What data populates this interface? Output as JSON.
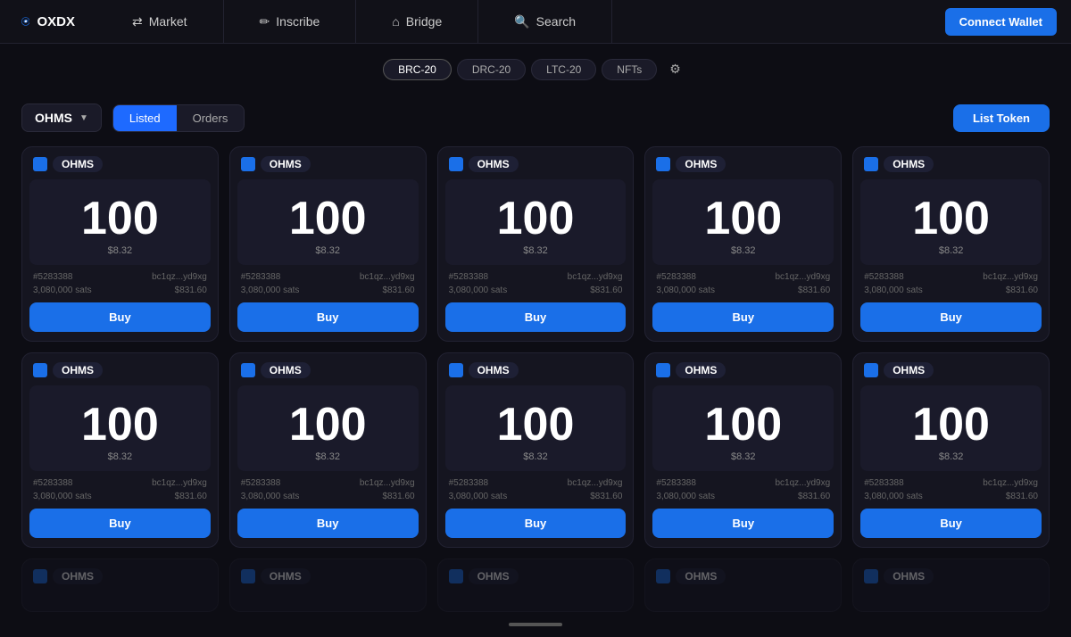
{
  "brand": {
    "name": "OXDX"
  },
  "nav": {
    "items": [
      {
        "label": "Market",
        "icon": "⇄"
      },
      {
        "label": "Inscribe",
        "icon": "✏"
      },
      {
        "label": "Bridge",
        "icon": "⌂"
      },
      {
        "label": "Search",
        "icon": "🔍"
      }
    ],
    "connect_wallet_label": "Connect Wallet"
  },
  "token_tabs": [
    {
      "label": "BRC-20",
      "active": true
    },
    {
      "label": "DRC-20",
      "active": false
    },
    {
      "label": "LTC-20",
      "active": false
    },
    {
      "label": "NFTs",
      "active": false
    }
  ],
  "filter": {
    "token": "OHMS",
    "views": [
      "Listed",
      "Orders"
    ],
    "active_view": "Listed",
    "list_token_label": "List Token"
  },
  "cards": [
    {
      "id": "#5283388",
      "wallet": "bc1qz...yd9xg",
      "amount": "100",
      "usd": "$8.32",
      "sats": "3,080,000 sats",
      "price": "$831.60"
    },
    {
      "id": "#5283388",
      "wallet": "bc1qz...yd9xg",
      "amount": "100",
      "usd": "$8.32",
      "sats": "3,080,000 sats",
      "price": "$831.60"
    },
    {
      "id": "#5283388",
      "wallet": "bc1qz...yd9xg",
      "amount": "100",
      "usd": "$8.32",
      "sats": "3,080,000 sats",
      "price": "$831.60"
    },
    {
      "id": "#5283388",
      "wallet": "bc1qz...yd9xg",
      "amount": "100",
      "usd": "$8.32",
      "sats": "3,080,000 sats",
      "price": "$831.60"
    },
    {
      "id": "#5283388",
      "wallet": "bc1qz...yd9xg",
      "amount": "100",
      "usd": "$8.32",
      "sats": "3,080,000 sats",
      "price": "$831.60"
    },
    {
      "id": "#5283388",
      "wallet": "bc1qz...yd9xg",
      "amount": "100",
      "usd": "$8.32",
      "sats": "3,080,000 sats",
      "price": "$831.60"
    },
    {
      "id": "#5283388",
      "wallet": "bc1qz...yd9xg",
      "amount": "100",
      "usd": "$8.32",
      "sats": "3,080,000 sats",
      "price": "$831.60"
    },
    {
      "id": "#5283388",
      "wallet": "bc1qz...yd9xg",
      "amount": "100",
      "usd": "$8.32",
      "sats": "3,080,000 sats",
      "price": "$831.60"
    },
    {
      "id": "#5283388",
      "wallet": "bc1qz...yd9xg",
      "amount": "100",
      "usd": "$8.32",
      "sats": "3,080,000 sats",
      "price": "$831.60"
    },
    {
      "id": "#5283388",
      "wallet": "bc1qz...yd9xg",
      "amount": "100",
      "usd": "$8.32",
      "sats": "3,080,000 sats",
      "price": "$831.60"
    }
  ],
  "bottom_cards": [
    {
      "label": "OHMS"
    },
    {
      "label": "OHMS"
    },
    {
      "label": "OHMS"
    },
    {
      "label": "OHMS"
    },
    {
      "label": "OHMS"
    }
  ],
  "card_token_label": "OHMS",
  "card_buy_label": "Buy"
}
